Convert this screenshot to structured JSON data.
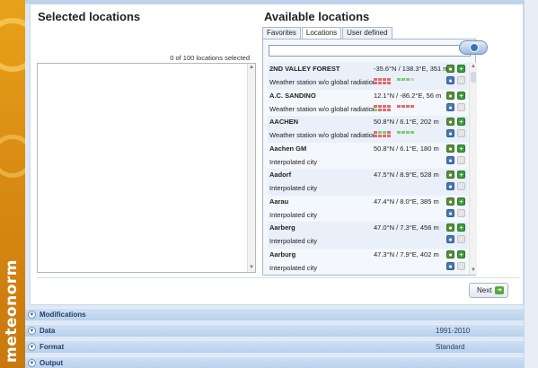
{
  "brand": {
    "logo_text": "meteonorm"
  },
  "selected": {
    "heading": "Selected locations",
    "count_text": "0 of 100 locations selected"
  },
  "available": {
    "heading": "Available locations",
    "tabs": [
      {
        "label": "Favorites",
        "active": false
      },
      {
        "label": "Locations",
        "active": true
      },
      {
        "label": "User defined",
        "active": false
      }
    ],
    "search_value": "",
    "items": [
      {
        "name": "2ND VALLEY FOREST",
        "coords": "-35.6°N / 138.3°E, 351 m",
        "type": "Weather station w/o global radiation",
        "quality": [
          "#e26a6a",
          "#e26a6a",
          "#e26a6a",
          "#e26a6a",
          "#e26a6a",
          "#e26a6a",
          "#e26a6a",
          "#e26a6a",
          "#7fce6e",
          "#7fce6e",
          "#7fce6e",
          "#cfcfcf"
        ]
      },
      {
        "name": "A.C. SANDINO",
        "coords": "12.1°N / -86.2°E, 56 m",
        "type": "Weather station w/o global radiation",
        "quality": [
          "#e26a6a",
          "#e26a6a",
          "#e26a6a",
          "#e26a6a",
          "#7fce6e",
          "#e26a6a",
          "#e26a6a",
          "#e26a6a",
          "#e26a6a",
          "#e26a6a",
          "#e26a6a",
          "#e26a6a"
        ]
      },
      {
        "name": "AACHEN",
        "coords": "50.8°N / 6.1°E, 202 m",
        "type": "Weather station w/o global radiation",
        "quality": [
          "#e26a6a",
          "#7fce6e",
          "#7fce6e",
          "#e26a6a",
          "#e26a6a",
          "#e26a6a",
          "#e26a6a",
          "#e26a6a",
          "#7fce6e",
          "#7fce6e",
          "#7fce6e",
          "#7fce6e"
        ]
      },
      {
        "name": "Aachen GM",
        "coords": "50.8°N / 6.1°E, 180 m",
        "type": "Interpolated city",
        "quality": []
      },
      {
        "name": "Aadorf",
        "coords": "47.5°N / 8.9°E, 528 m",
        "type": "Interpolated city",
        "quality": []
      },
      {
        "name": "Aarau",
        "coords": "47.4°N / 8.0°E, 385 m",
        "type": "Interpolated city",
        "quality": []
      },
      {
        "name": "Aarberg",
        "coords": "47.0°N / 7.3°E, 456 m",
        "type": "Interpolated city",
        "quality": []
      },
      {
        "name": "Aarburg",
        "coords": "47.3°N / 7.9°E, 402 m",
        "type": "Interpolated city",
        "quality": []
      }
    ]
  },
  "actions": {
    "next_label": "Next"
  },
  "sections": [
    {
      "title": "Modifications",
      "value": ""
    },
    {
      "title": "Data",
      "value": "1991-2010"
    },
    {
      "title": "Format",
      "value": "Standard"
    },
    {
      "title": "Output",
      "value": ""
    }
  ],
  "colors": {
    "accent": "#e8a21a",
    "section_blue": "#b9d0ec",
    "quality_bad": "#e26a6a",
    "quality_good": "#7fce6e"
  }
}
